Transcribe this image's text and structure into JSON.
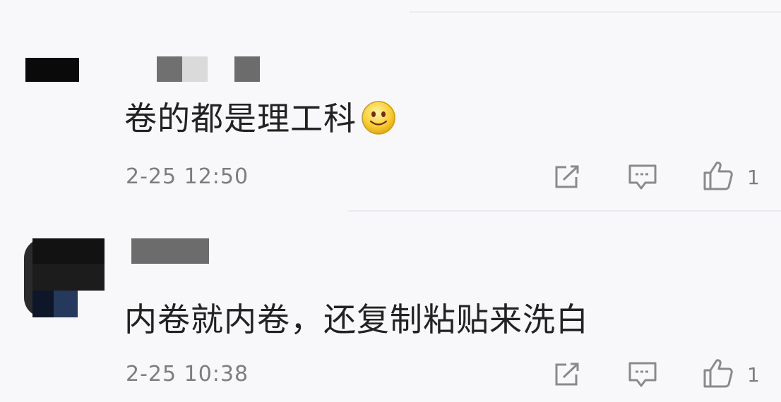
{
  "comments": [
    {
      "text": "卷的都是理工科",
      "emoji": "smiley-emoji",
      "timestamp": "2-25 12:50",
      "like_count": "1"
    },
    {
      "text": "内卷就内卷，还复制粘贴来洗白",
      "timestamp": "2-25 10:38",
      "like_count": "1"
    }
  ],
  "icons": {
    "share": "share-icon",
    "reply": "reply-icon",
    "like": "thumbs-up-icon"
  },
  "colors": {
    "background": "#f8f8fa",
    "text": "#222222",
    "meta": "#7d7d7d",
    "icon": "#8a8a8a"
  }
}
